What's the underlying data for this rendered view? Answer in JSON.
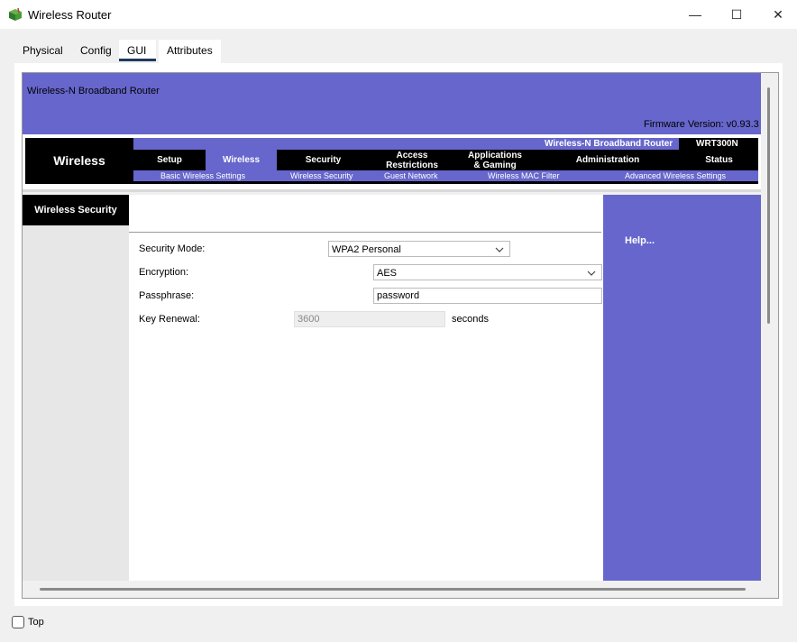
{
  "window": {
    "title": "Wireless Router",
    "controls": {
      "minimize": "—",
      "maximize": "☐",
      "close": "✕"
    }
  },
  "tabs": [
    {
      "label": "Physical",
      "active": false
    },
    {
      "label": "Config",
      "active": false
    },
    {
      "label": "GUI",
      "active": true
    },
    {
      "label": "Attributes",
      "active": false
    }
  ],
  "router": {
    "header_title": "Wireless-N Broadband Router",
    "firmware": "Firmware Version: v0.93.3",
    "section_label": "Wireless",
    "product_name": "Wireless-N Broadband Router",
    "model": "WRT300N",
    "nav": [
      {
        "label": "Setup",
        "active": false
      },
      {
        "label": "Wireless",
        "active": true
      },
      {
        "label": "Security",
        "active": false
      },
      {
        "label": "Access\nRestrictions",
        "active": false
      },
      {
        "label": "Applications\n& Gaming",
        "active": false
      },
      {
        "label": "Administration",
        "active": false
      },
      {
        "label": "Status",
        "active": false
      }
    ],
    "subnav": [
      "Basic Wireless Settings",
      "Wireless Security",
      "Guest Network",
      "Wireless MAC Filter",
      "Advanced Wireless Settings"
    ],
    "page_section_title": "Wireless Security",
    "form": {
      "security_mode_label": "Security Mode:",
      "security_mode_value": "WPA2 Personal",
      "encryption_label": "Encryption:",
      "encryption_value": "AES",
      "passphrase_label": "Passphrase:",
      "passphrase_value": "password",
      "key_renewal_label": "Key Renewal:",
      "key_renewal_value": "3600",
      "key_renewal_unit": "seconds"
    },
    "help": "Help..."
  },
  "footer": {
    "top_label": "Top",
    "top_checked": false
  },
  "colors": {
    "accent": "#6666cc",
    "nav_black": "#000000"
  }
}
